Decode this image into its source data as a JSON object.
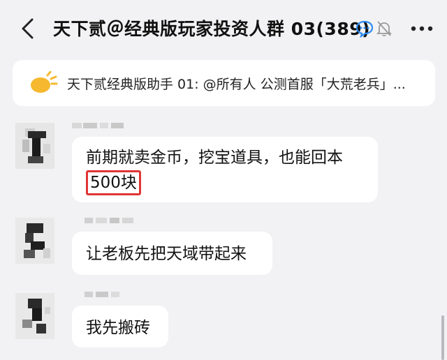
{
  "header": {
    "title": "天下贰＠经典版玩家投资人群 03(389)",
    "back_icon": "chevron-left-icon",
    "chat_icon": "chat-bubble-icon",
    "bell_icon": "bell-muted-icon",
    "more_icon": "more-dots-icon"
  },
  "notice": {
    "icon": "sun-announcement-icon",
    "text": "天下贰经典版助手 01: @所有人  公测首服「大荒老兵」..."
  },
  "messages": [
    {
      "line1": "前期就卖金币，挖宝道具，也能回本",
      "line2": "500块"
    },
    {
      "text": "让老板先把天域带起来"
    },
    {
      "text": "我先搬砖"
    }
  ],
  "colors": {
    "background": "#f2f2f4",
    "bubble": "#ffffff",
    "highlight": "#e03535",
    "notice_icon": "#f5b82e"
  }
}
